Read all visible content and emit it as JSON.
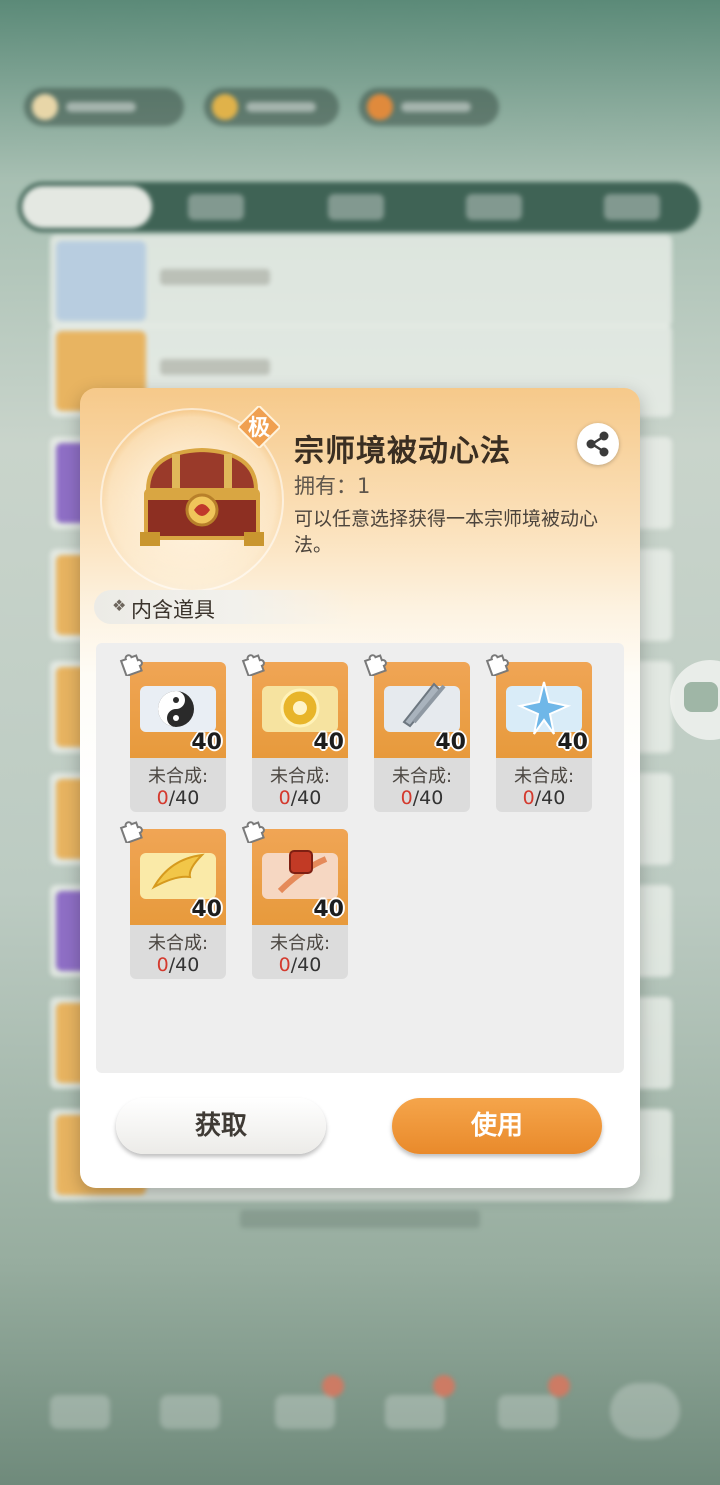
{
  "dialog": {
    "rarity_badge": "极",
    "title": "宗师境被动心法",
    "owned_label": "拥有：1",
    "description": "可以任意选择获得一本宗师境被动心法。",
    "section_label": "内含道具",
    "items": [
      {
        "qty": "40",
        "label": "未合成:",
        "current": "0",
        "total": "/40",
        "art_icon": "taiji-scroll-icon",
        "accent": "#2a2a2a"
      },
      {
        "qty": "40",
        "label": "未合成:",
        "current": "0",
        "total": "/40",
        "art_icon": "golden-emblem-scroll-icon",
        "accent": "#e8b52a"
      },
      {
        "qty": "40",
        "label": "未合成:",
        "current": "0",
        "total": "/40",
        "art_icon": "silver-blade-scroll-icon",
        "accent": "#a9b3bd"
      },
      {
        "qty": "40",
        "label": "未合成:",
        "current": "0",
        "total": "/40",
        "art_icon": "ice-star-scroll-icon",
        "accent": "#6fb7e8"
      },
      {
        "qty": "40",
        "label": "未合成:",
        "current": "0",
        "total": "/40",
        "art_icon": "golden-phoenix-scroll-icon",
        "accent": "#f2c648"
      },
      {
        "qty": "40",
        "label": "未合成:",
        "current": "0",
        "total": "/40",
        "art_icon": "red-seal-scroll-icon",
        "accent": "#c23a25"
      }
    ],
    "get_button": "获取",
    "use_button": "使用"
  },
  "colors": {
    "use_button": "#e98a2b",
    "progress_current": "#d43a2e",
    "item_art_bg": "#f0a555"
  }
}
